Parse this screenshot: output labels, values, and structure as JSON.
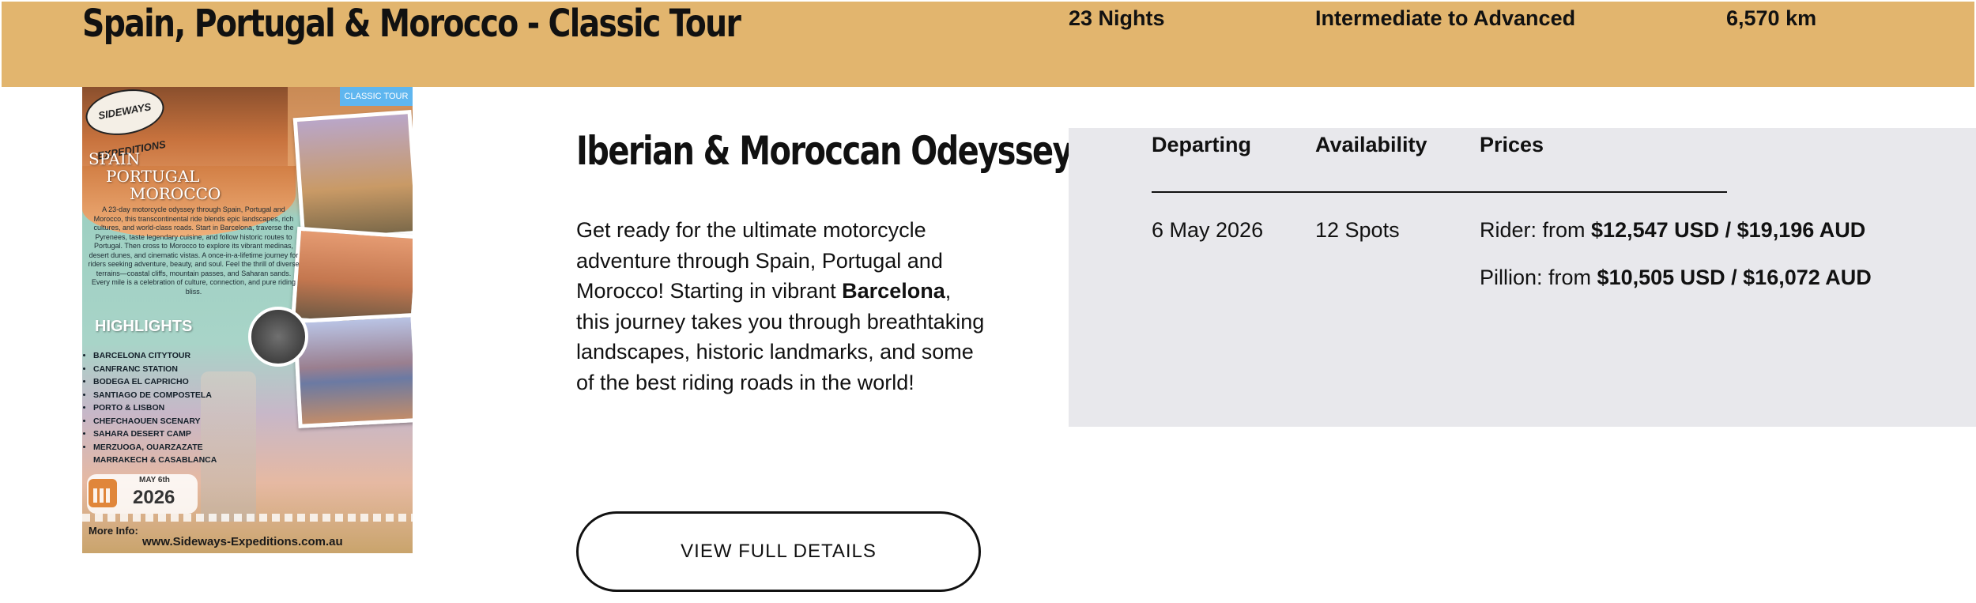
{
  "header": {
    "title": "Spain, Portugal & Morocco - Classic Tour",
    "nights": "23 Nights",
    "level": "Intermediate to Advanced",
    "distance": "6,570 km",
    "background_color": "#e2b56e"
  },
  "poster": {
    "logo_text": "SIDEWAYS EXPEDITIONS",
    "ribbon": "CLASSIC TOUR",
    "headline_1": "SPAIN",
    "headline_2": "PORTUGAL",
    "headline_3": "MOROCCO",
    "blurb": "A 23-day motorcycle odyssey through Spain, Portugal and Morocco, this transcontinental ride blends epic landscapes, rich cultures, and world-class roads. Start in Barcelona, traverse the Pyrenees, taste legendary cuisine, and follow historic routes to Portugal. Then cross to Morocco to explore its vibrant medinas, desert dunes, and cinematic vistas. A once-in-a-lifetime journey for riders seeking adventure, beauty, and soul. Feel the thrill of diverse terrains—coastal cliffs, mountain passes, and Saharan sands. Every mile is a celebration of culture, connection, and pure riding bliss.",
    "highlights_title": "HIGHLIGHTS",
    "highlights": [
      "BARCELONA CITYTOUR",
      "CANFRANC STATION",
      "BODEGA EL CAPRICHO",
      "SANTIAGO DE COMPOSTELA",
      "PORTO & LISBON",
      "CHEFCHAOUEN SCENARY",
      "SAHARA DESERT CAMP",
      "MERZUOGA, OUARZAZATE",
      "MARRAKECH & CASABLANCA"
    ],
    "date_month": "MAY 6th",
    "date_year": "2026",
    "more_info": "More Info:",
    "website": "www.Sideways-Expeditions.com.au"
  },
  "description": {
    "title": "Iberian & Moroccan Odeyssey",
    "text_before": "Get ready for the ultimate motorcycle adventure through Spain, Portugal and Morocco! Starting in vibrant ",
    "text_bold": "Barcelona",
    "text_after": ", this journey takes you through breathtaking landscapes, historic landmarks, and some of the best riding roads in the world!",
    "button_label": "VIEW FULL DETAILS"
  },
  "departures": {
    "headers": [
      "Departing",
      "Availability",
      "Prices"
    ],
    "row": {
      "departing": "6 May 2026",
      "availability": "12 Spots",
      "rider_label": "Rider: from ",
      "rider_price": "$12,547 USD / $19,196 AUD",
      "pillion_label": "Pillion: from ",
      "pillion_price": "$10,505 USD / $16,072 AUD"
    },
    "panel_color": "#e8e8ec"
  }
}
